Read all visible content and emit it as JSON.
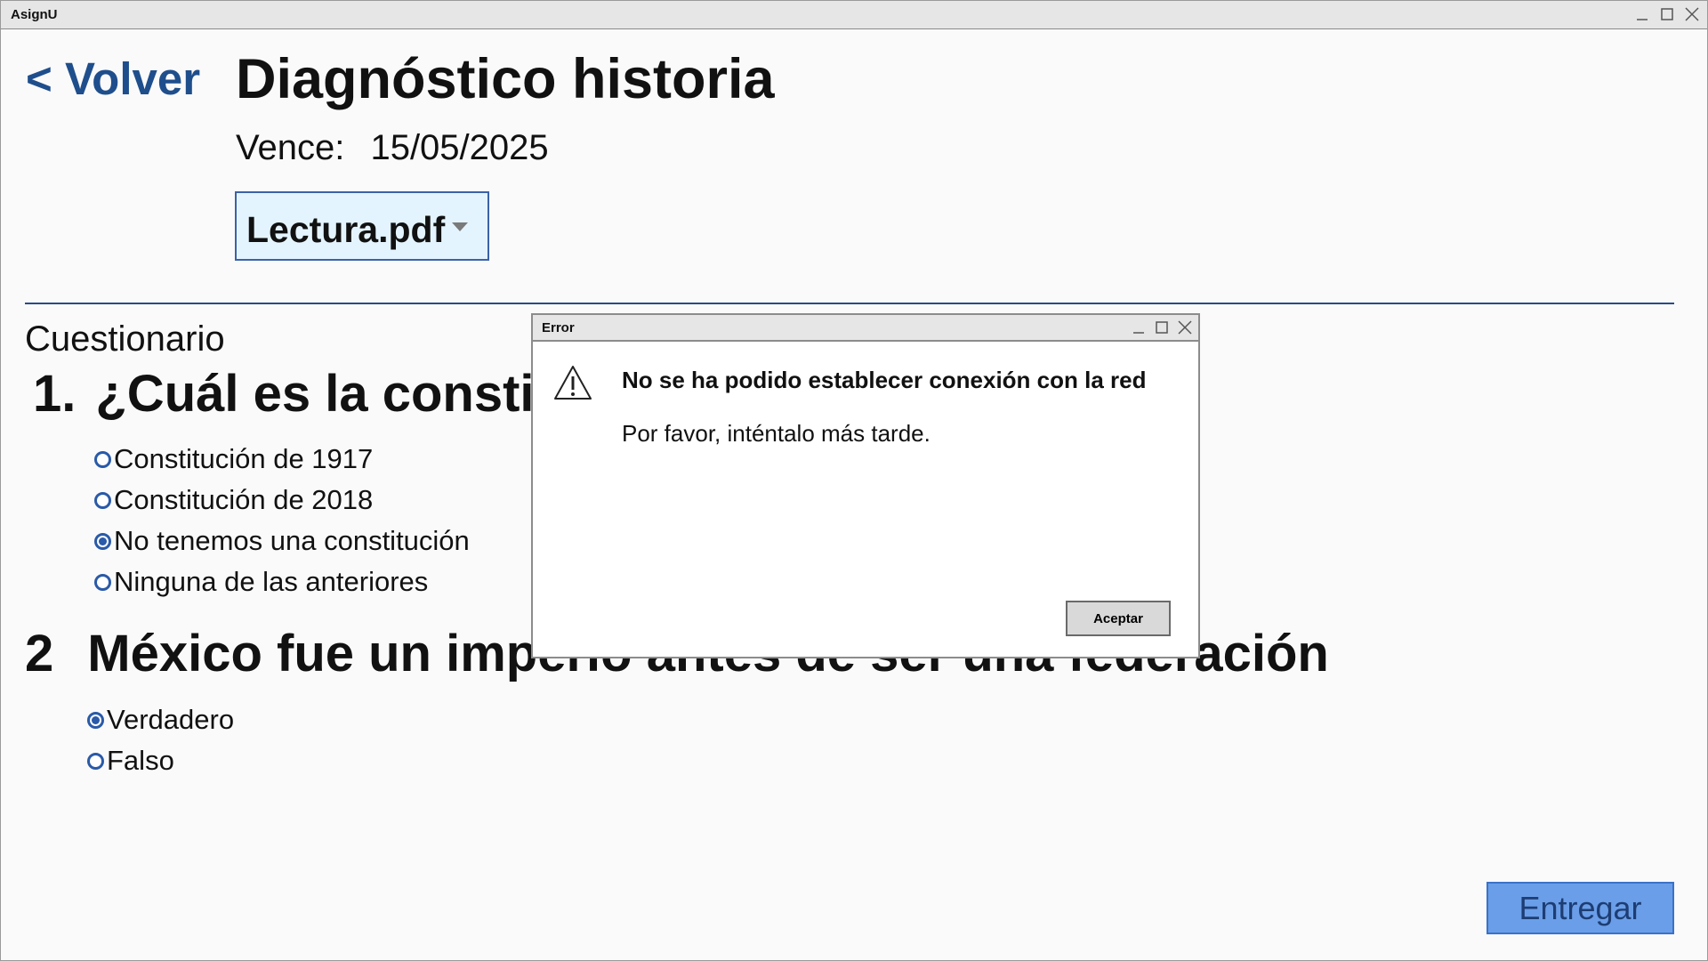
{
  "window": {
    "title": "AsignU",
    "controls": [
      "minimize-icon",
      "maximize-icon",
      "close-icon"
    ]
  },
  "header": {
    "back_label": "< Volver",
    "title": "Diagnóstico historia",
    "due_label": "Vence:",
    "due_date": "15/05/2025",
    "file_select_value": "Lectura.pdf"
  },
  "quiz": {
    "section_title": "Cuestionario",
    "questions": [
      {
        "number": "1.",
        "text": "¿Cuál es la constitución vigente?",
        "options": [
          {
            "label": "Constitución de 1917",
            "selected": false
          },
          {
            "label": "Constitución de 2018",
            "selected": false
          },
          {
            "label": "No tenemos una constitución",
            "selected": true
          },
          {
            "label": "Ninguna de las anteriores",
            "selected": false
          }
        ]
      },
      {
        "number": "2",
        "text": "México fue un imperio antes de ser una federación",
        "options": [
          {
            "label": "Verdadero",
            "selected": true
          },
          {
            "label": "Falso",
            "selected": false
          }
        ]
      }
    ]
  },
  "submit_label": "Entregar",
  "error_dialog": {
    "title": "Error",
    "icon": "warning-icon",
    "heading": "No se ha podido establecer conexión con la red",
    "message": "Por favor, inténtalo más tarde.",
    "ok_label": "Aceptar"
  },
  "colors": {
    "accent_blue": "#1f4e8c",
    "select_bg": "#e4f4fe",
    "submit_bg": "#6a9ee8",
    "radio": "#2a5aa8"
  }
}
